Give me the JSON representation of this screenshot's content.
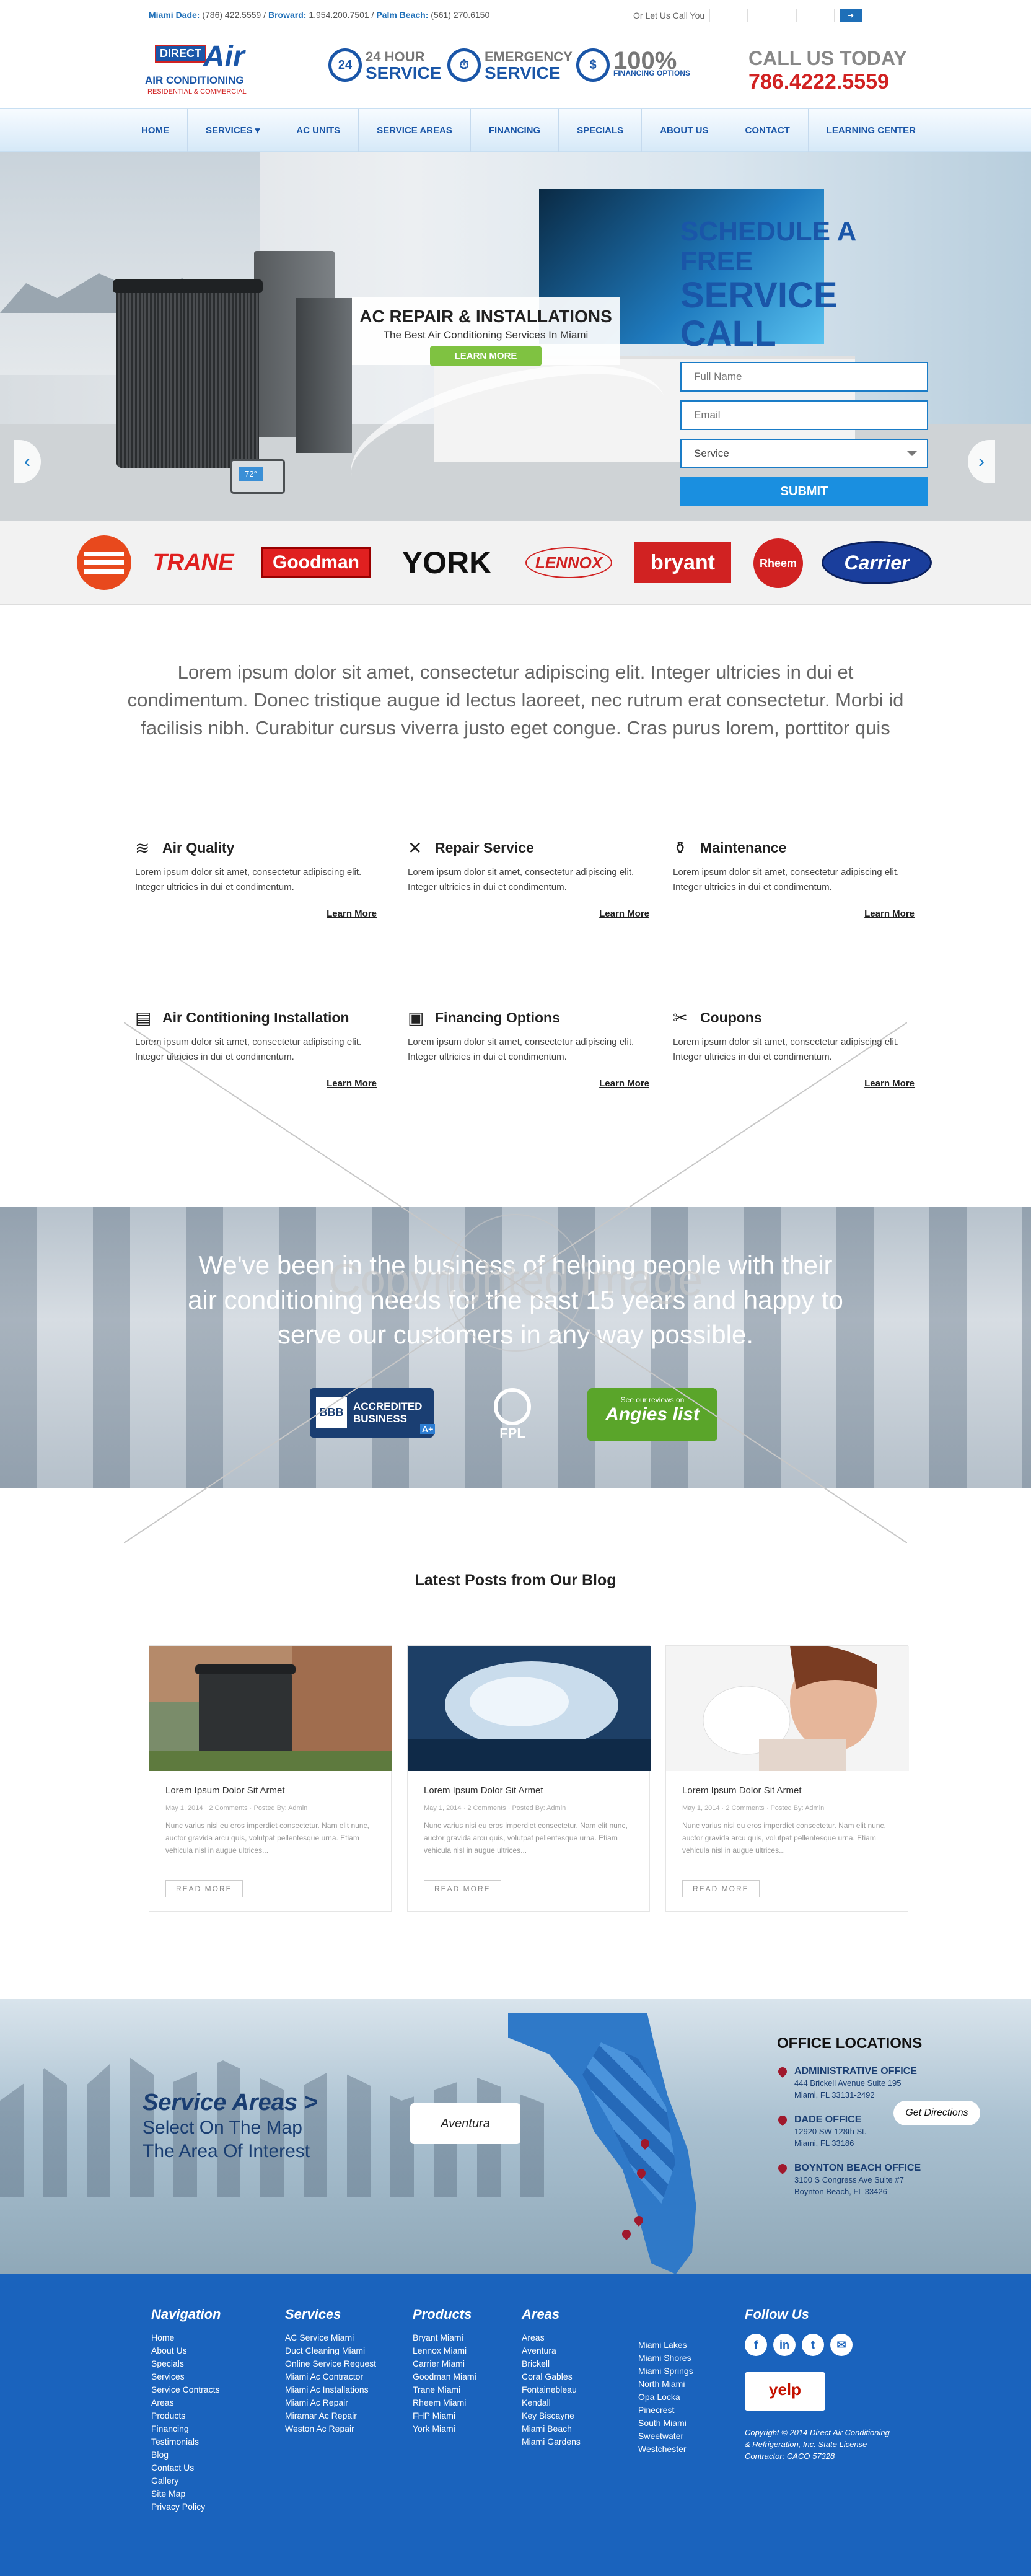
{
  "topbar": {
    "miami_label": "Miami Dade:",
    "miami_phone": "(786) 422.5559 /",
    "broward_label": "Broward:",
    "broward_phone": "1.954.200.7501 /",
    "palm_label": "Palm Beach:",
    "palm_phone": "(561) 270.6150",
    "callyou": "Or Let Us Call You"
  },
  "logo": {
    "direct": "DIRECT",
    "air": "Air",
    "ac": "AIR CONDITIONING",
    "rc": "RESIDENTIAL & COMMERCIAL"
  },
  "badges": [
    {
      "icon": "24",
      "small": "24 HOUR",
      "large": "SERVICE"
    },
    {
      "icon": "⏱",
      "small": "EMERGENCY",
      "large": "SERVICE"
    },
    {
      "icon": "$",
      "small": "100%",
      "large": "FINANCING OPTIONS"
    }
  ],
  "callus": {
    "label": "CALL US TODAY",
    "phone": "786.4222.5559"
  },
  "nav": [
    "HOME",
    "SERVICES ▾",
    "AC UNITS",
    "SERVICE AREAS",
    "FINANCING",
    "SPECIALS",
    "ABOUT US",
    "CONTACT",
    "LEARNING CENTER"
  ],
  "hero": {
    "title": "AC REPAIR & INSTALLATIONS",
    "subtitle": "The Best Air Conditioning Services In Miami",
    "button": "LEARN MORE",
    "thermostat": "72°"
  },
  "form": {
    "title1": "SCHEDULE A FREE",
    "title2": "SERVICE CALL",
    "name_ph": "Full Name",
    "email_ph": "Email",
    "service": "Service",
    "submit": "SUBMIT"
  },
  "brands": [
    "TRANE",
    "Goodman",
    "YORK",
    "LENNOX",
    "bryant",
    "Rheem",
    "Carrier"
  ],
  "intro": "Lorem ipsum dolor sit amet, consectetur adipiscing elit. Integer ultricies in dui et condimentum. Donec tristique augue id lectus laoreet, nec rutrum erat consectetur. Morbi id facilisis nibh. Curabitur cursus viverra justo eget congue. Cras purus lorem, porttitor quis",
  "features": [
    {
      "icon": "≋",
      "title": "Air Quality",
      "text": "Lorem ipsum dolor sit amet, consectetur adipiscing elit. Integer ultricies in dui et condimentum.",
      "more": "Learn More"
    },
    {
      "icon": "✕",
      "title": "Repair Service",
      "text": "Lorem ipsum dolor sit amet, consectetur adipiscing elit. Integer ultricies in dui et condimentum.",
      "more": "Learn More"
    },
    {
      "icon": "⚱",
      "title": "Maintenance",
      "text": "Lorem ipsum dolor sit amet, consectetur adipiscing elit. Integer ultricies in dui et condimentum.",
      "more": "Learn More"
    },
    {
      "icon": "▤",
      "title": "Air Contitioning Installation",
      "text": "Lorem ipsum dolor sit amet, consectetur adipiscing elit. Integer ultricies in dui et condimentum.",
      "more": "Learn More"
    },
    {
      "icon": "▣",
      "title": "Financing Options",
      "text": "Lorem ipsum dolor sit amet, consectetur adipiscing elit. Integer ultricies in dui et condimentum.",
      "more": "Learn More"
    },
    {
      "icon": "✂",
      "title": "Coupons",
      "text": "Lorem ipsum dolor sit amet, consectetur adipiscing elit. Integer ultricies in dui et condimentum.",
      "more": "Learn More"
    }
  ],
  "trust": {
    "quote": "We've been in the business of helping people with their air conditioning needs for the past 15 years and happy to serve our customers in any way possible.",
    "bbb_a": "BBB",
    "bbb_b": "ACCREDITED BUSINESS",
    "bbb_c": "A+",
    "fpl": "FPL",
    "angies_s": "See our reviews on",
    "angies_n": "Angies list",
    "watermark": "Copyrighted image"
  },
  "blog": {
    "title": "Latest Posts from Our Blog",
    "posts": [
      {
        "title": "Lorem Ipsum Dolor Sit Armet",
        "meta": "May 1, 2014  ·  2 Comments  ·  Posted By: Admin",
        "text": "Nunc varius nisi eu eros imperdiet consectetur. Nam elit nunc, auctor gravida arcu quis, volutpat pellentesque urna. Etiam vehicula nisl in augue ultrices...",
        "more": "READ MORE"
      },
      {
        "title": "Lorem Ipsum Dolor Sit Armet",
        "meta": "May 1, 2014  ·  2 Comments  ·  Posted By: Admin",
        "text": "Nunc varius nisi eu eros imperdiet consectetur. Nam elit nunc, auctor gravida arcu quis, volutpat pellentesque urna. Etiam vehicula nisl in augue ultrices...",
        "more": "READ MORE"
      },
      {
        "title": "Lorem Ipsum Dolor Sit Armet",
        "meta": "May 1, 2014  ·  2 Comments  ·  Posted By: Admin",
        "text": "Nunc varius nisi eu eros imperdiet consectetur. Nam elit nunc, auctor gravida arcu quis, volutpat pellentesque urna. Etiam vehicula nisl in augue ultrices...",
        "more": "READ MORE"
      }
    ]
  },
  "areas": {
    "title": "Service Areas >",
    "sub1": "Select On The Map",
    "sub2": "The Area Of Interest",
    "tooltip": "Aventura",
    "offices_title": "OFFICE LOCATIONS",
    "directions": "Get Directions",
    "offices": [
      {
        "name": "ADMINISTRATIVE OFFICE",
        "a1": "444 Brickell Avenue Suite 195",
        "a2": "Miami, FL 33131-2492"
      },
      {
        "name": "DADE OFFICE",
        "a1": "12920 SW 128th St.",
        "a2": "Miami, FL 33186"
      },
      {
        "name": "BOYNTON BEACH OFFICE",
        "a1": "3100 S Congress Ave Suite #7",
        "a2": "Boynton Beach, FL 33426"
      }
    ]
  },
  "footer": {
    "navigation": {
      "title": "Navigation",
      "items": [
        "Home",
        "About Us",
        "Specials",
        "Services",
        "Service Contracts",
        "Areas",
        "Products",
        "Financing",
        "Testimonials",
        "Blog",
        "Contact Us",
        "Gallery",
        "Site Map",
        "Privacy Policy"
      ]
    },
    "services": {
      "title": "Services",
      "items": [
        "AC Service Miami",
        "Duct Cleaning Miami",
        "Online Service Request",
        "Miami Ac Contractor",
        "Miami Ac Installations",
        "Miami Ac Repair",
        "Miramar Ac Repair",
        "Weston Ac Repair"
      ]
    },
    "products": {
      "title": "Products",
      "items": [
        "Bryant Miami",
        "Lennox Miami",
        "Carrier Miami",
        "Goodman Miami",
        "Trane Miami",
        "Rheem Miami",
        "FHP Miami",
        "York Miami"
      ]
    },
    "areas": {
      "title": "Areas",
      "items": [
        "Areas",
        "Aventura",
        "Brickell",
        "Coral Gables",
        "Fontainebleau",
        "Kendall",
        "Key Biscayne",
        "Miami Beach",
        "Miami Gardens"
      ]
    },
    "areas2": {
      "items": [
        "Miami Lakes",
        "Miami Shores",
        "Miami Springs",
        "North Miami",
        "Opa Locka",
        "Pinecrest",
        "South Miami",
        "Sweetwater",
        "Westchester"
      ]
    },
    "follow": {
      "title": "Follow Us",
      "icons": [
        "f",
        "in",
        "t",
        "✉"
      ],
      "yelp": "yelp",
      "copy": "Copyright © 2014 Direct Air Conditioning & Refrigeration, Inc. State License Contractor: CACO 57328"
    }
  }
}
